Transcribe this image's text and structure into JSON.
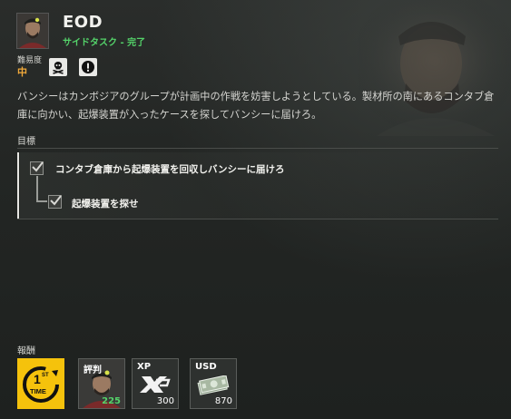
{
  "mission": {
    "title": "EOD",
    "subtitle": "サイドタスク - 完了",
    "difficulty_label": "難易度",
    "difficulty_value": "中",
    "description": "バンシーはカンボジアのグループが計画中の作戦を妨害しようとしている。製材所の南にあるコンタブ倉庫に向かい、起爆装置が入ったケースを探してバンシーに届けろ。"
  },
  "difficulty_icons": [
    "skull-crossbones-icon",
    "exclamation-icon"
  ],
  "objectives": {
    "label": "目標",
    "main": "コンタブ倉庫から起爆装置を回収しバンシーに届けろ",
    "sub": "起爆装置を探せ"
  },
  "rewards": {
    "label": "報酬",
    "items": [
      {
        "name": "first-time-bonus",
        "text_top": "1",
        "text_sup": "ST",
        "text_bottom": "TIME"
      },
      {
        "name": "reputation",
        "tag": "評判",
        "value": "225"
      },
      {
        "name": "xp",
        "tag": "XP",
        "value": "300"
      },
      {
        "name": "usd",
        "tag": "USD",
        "value": "870"
      }
    ]
  },
  "colors": {
    "accent_green": "#54d36a",
    "difficulty_orange": "#f1a93a",
    "first_time_yellow": "#f5c20c"
  }
}
